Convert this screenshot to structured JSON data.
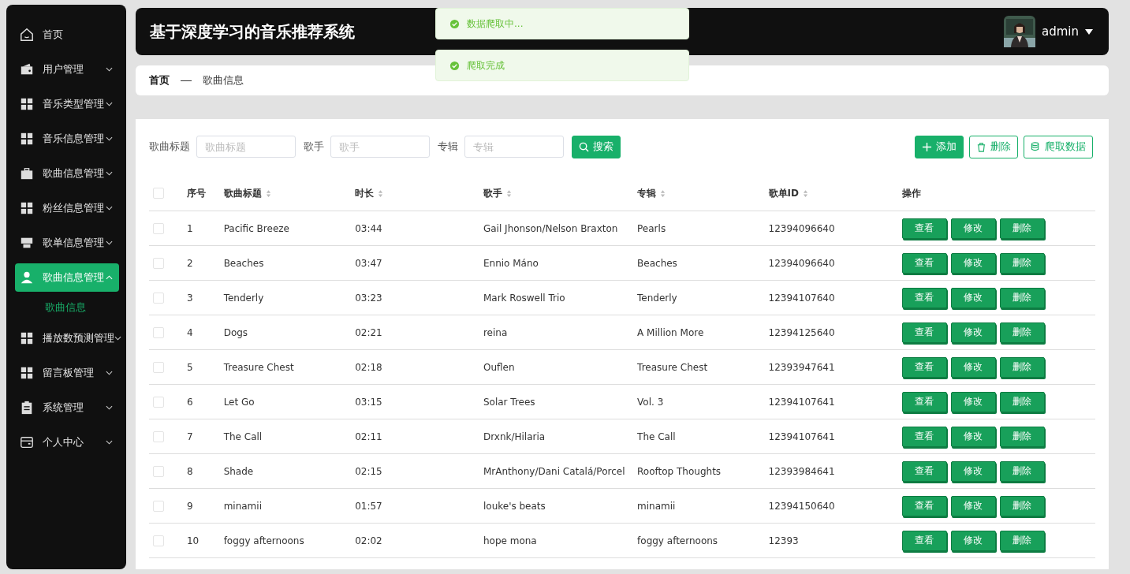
{
  "sidebar": {
    "items": [
      {
        "label": "首页",
        "kind": "home",
        "selected": false
      },
      {
        "label": "用户管理",
        "kind": "wallet",
        "selected": false,
        "expanded": false
      },
      {
        "label": "音乐类型管理",
        "kind": "grid",
        "selected": false,
        "expanded": false
      },
      {
        "label": "音乐信息管理",
        "kind": "grid",
        "selected": false,
        "expanded": false
      },
      {
        "label": "歌曲信息管理",
        "kind": "briefcase",
        "selected": false,
        "expanded": false
      },
      {
        "label": "粉丝信息管理",
        "kind": "grid",
        "selected": false,
        "expanded": false
      },
      {
        "label": "歌单信息管理",
        "kind": "store",
        "selected": false,
        "expanded": false
      },
      {
        "label": "歌曲信息管理",
        "kind": "user",
        "selected": true,
        "expanded": true,
        "children": [
          {
            "label": "歌曲信息",
            "selected": true
          }
        ]
      },
      {
        "label": "播放数预测管理",
        "kind": "grid",
        "selected": false,
        "expanded": false
      },
      {
        "label": "留言板管理",
        "kind": "grid",
        "selected": false,
        "expanded": false
      },
      {
        "label": "系统管理",
        "kind": "clipboard",
        "selected": false,
        "expanded": false
      },
      {
        "label": "个人中心",
        "kind": "card",
        "selected": false,
        "expanded": false
      }
    ]
  },
  "header": {
    "title": "基于深度学习的音乐推荐系统",
    "user": "admin"
  },
  "toasts": [
    {
      "message": "数据爬取中..."
    },
    {
      "message": "爬取完成"
    }
  ],
  "breadcrumb": [
    "首页",
    "歌曲信息"
  ],
  "search": {
    "fields": [
      {
        "label": "歌曲标题",
        "placeholder": "歌曲标题"
      },
      {
        "label": "歌手",
        "placeholder": "歌手"
      },
      {
        "label": "专辑",
        "placeholder": "专辑"
      }
    ],
    "button": "搜索"
  },
  "toolbar": [
    {
      "label": "添加",
      "kind": "add"
    },
    {
      "label": "删除",
      "kind": "delete"
    },
    {
      "label": "爬取数据",
      "kind": "fetch"
    }
  ],
  "table": {
    "select_all_checked": false,
    "columns": [
      {
        "label": "序号",
        "sortable": false
      },
      {
        "label": "歌曲标题",
        "sortable": true
      },
      {
        "label": "时长",
        "sortable": true
      },
      {
        "label": "歌手",
        "sortable": true
      },
      {
        "label": "专辑",
        "sortable": true
      },
      {
        "label": "歌单ID",
        "sortable": true
      },
      {
        "label": "操作",
        "sortable": false
      }
    ],
    "rows": [
      {
        "checked": false,
        "cells": [
          "1",
          "Pacific Breeze",
          "03:44",
          "Gail Jhonson/Nelson Braxton",
          "Pearls",
          "12394096640"
        ],
        "actions": [
          "查看",
          "修改",
          "删除"
        ]
      },
      {
        "checked": false,
        "cells": [
          "2",
          "Beaches",
          "03:47",
          "Ennio Máno",
          "Beaches",
          "12394096640"
        ],
        "actions": [
          "查看",
          "修改",
          "删除"
        ]
      },
      {
        "checked": false,
        "cells": [
          "3",
          "Tenderly",
          "03:23",
          "Mark Roswell Trio",
          "Tenderly",
          "12394107640"
        ],
        "actions": [
          "查看",
          "修改",
          "删除"
        ]
      },
      {
        "checked": false,
        "cells": [
          "4",
          "Dogs",
          "02:21",
          "reina",
          "A Million More",
          "12394125640"
        ],
        "actions": [
          "查看",
          "修改",
          "删除"
        ]
      },
      {
        "checked": false,
        "cells": [
          "5",
          "Treasure Chest",
          "02:18",
          "Ouflen",
          "Treasure Chest",
          "12393947641"
        ],
        "actions": [
          "查看",
          "修改",
          "删除"
        ]
      },
      {
        "checked": false,
        "cells": [
          "6",
          "Let Go",
          "03:15",
          "Solar Trees",
          "Vol. 3",
          "12394107641"
        ],
        "actions": [
          "查看",
          "修改",
          "删除"
        ]
      },
      {
        "checked": false,
        "cells": [
          "7",
          "The Call",
          "02:11",
          "Drxnk/Hilaria",
          "The Call",
          "12394107641"
        ],
        "actions": [
          "查看",
          "修改",
          "删除"
        ]
      },
      {
        "checked": false,
        "cells": [
          "8",
          "Shade",
          "02:15",
          "MrAnthony/Dani Catalá/Porcel",
          "Rooftop Thoughts",
          "12393984641"
        ],
        "actions": [
          "查看",
          "修改",
          "删除"
        ]
      },
      {
        "checked": false,
        "cells": [
          "9",
          "minamii",
          "01:57",
          "louke's beats",
          "minamii",
          "12394150640"
        ],
        "actions": [
          "查看",
          "修改",
          "删除"
        ]
      },
      {
        "checked": false,
        "cells": [
          "10",
          "foggy afternoons",
          "02:02",
          "hope mona",
          "foggy afternoons",
          "12393"
        ],
        "actions": [
          "查看",
          "修改",
          "删除"
        ]
      }
    ]
  }
}
